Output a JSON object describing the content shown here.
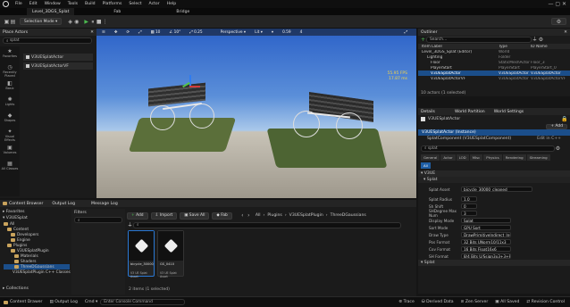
{
  "menubar": {
    "items": [
      "File",
      "Edit",
      "Window",
      "Tools",
      "Build",
      "Platforms",
      "Select",
      "Actor",
      "Help"
    ]
  },
  "tabs": {
    "level": "Level_3DGS_Splat",
    "fab": "Fab",
    "bridge": "Bridge"
  },
  "toolbar": {
    "mode": "Selection Mode"
  },
  "place_actors": {
    "title": "Place Actors",
    "search": "splat",
    "categories": [
      "Favorites",
      "Recently Placed",
      "Basic",
      "Lights",
      "Shapes",
      "Visual Effects",
      "Volumes",
      "All Classes"
    ],
    "results": [
      "V3UESplatActor",
      "V3UESplatActorVF"
    ]
  },
  "viewport": {
    "perspective": "Perspective",
    "lit": "Lit",
    "show": "Show",
    "snap_move": "10",
    "snap_rot": "10°",
    "snap_scale": "0.25",
    "speed": "4",
    "fps_ms": "55.95 FPS",
    "ms": "17.87 ms",
    "cam_speed": "0.59"
  },
  "outliner": {
    "title": "Outliner",
    "search": "Search...",
    "col_label": "Item Label",
    "col_type": "Type",
    "col_idname": "ID Name",
    "rows": [
      {
        "label": "Level_3DGS_Splat (Editor)",
        "type": "World",
        "id": ""
      },
      {
        "label": "Lighting",
        "type": "Folder",
        "id": ""
      },
      {
        "label": "Floor",
        "type": "StaticMeshActor",
        "id": "Floor_3"
      },
      {
        "label": "PlayerStart",
        "type": "PlayerStart",
        "id": "PlayerStart_0"
      },
      {
        "label": "V3UESplatActor",
        "type": "V3UESplatActor",
        "id": "V3UESplatActor"
      },
      {
        "label": "V3UESplatActorVF",
        "type": "V3UESplatActor",
        "id": "V3UESplatActorVF"
      }
    ],
    "summary": "10 actors (1 selected)"
  },
  "details": {
    "tab_details": "Details",
    "tab_world_partition": "World Partition",
    "tab_world_settings": "World Settings",
    "actor_name": "V3UESplatActor",
    "instance": "V3UESplatActor (Instance)",
    "component": "SplatComponent (V3UESplatComponent)",
    "add": "+ Add",
    "edit_cpp": "Edit in C++",
    "search": "splat",
    "cat_tabs": [
      "General",
      "Actor",
      "LOD",
      "Misc",
      "Physics",
      "Rendering",
      "Streaming"
    ],
    "all": "All",
    "section_v3ue": "V3UE",
    "section_splat": "Splat",
    "props": [
      {
        "label": "Splat Asset",
        "value": "bicycle_30000_cleaned"
      },
      {
        "label": "Splat Radius",
        "value": "1.0"
      },
      {
        "label": "Sh Shift",
        "value": "0"
      },
      {
        "label": "SHDegree Max Num",
        "value": "3"
      },
      {
        "label": "Display Mode",
        "value": "Splat"
      },
      {
        "label": "Sort Mode",
        "value": "GPU Sort"
      },
      {
        "label": "Draw Type",
        "value": "DrawPrimitiveIndirect_InstPerSPSheet"
      },
      {
        "label": "Pos Format",
        "value": "32 Bits UNorm10/11x3"
      },
      {
        "label": "Cov Format",
        "value": "16 Bits Float16x6"
      },
      {
        "label": "SH Format",
        "value": "8/4 Bits U/Ssign3x3+3+8x3"
      }
    ],
    "section_bottom": "Splat"
  },
  "content_browser": {
    "tab_cb": "Content Browser",
    "tab_output": "Output Log",
    "tab_msg": "Message Log",
    "add": "Add",
    "import": "Import",
    "save_all": "Save All",
    "fab": "Fab",
    "favorites": "Favorites",
    "project": "V3UESplat",
    "tree": [
      "All",
      "Content",
      "Developers",
      "Engine",
      "Plugins",
      "V3UESplatPlugin",
      "Materials",
      "Shaders",
      "ThreeDGaussians",
      "V3UESplatPlugin C++ Classes"
    ],
    "filters": "Filters",
    "breadcrumb": [
      "All",
      "Plugins",
      "V3UESplatPlugin",
      "ThreeDGaussians"
    ],
    "search_assets": "Search ThreeDGaussians",
    "assets": [
      {
        "name": "bicycle_30000_cleaned",
        "type": "V3 UE Splat Asset"
      },
      {
        "name": "GS_0410",
        "type": "V3 UE Splat Asset"
      }
    ],
    "count": "2 items (1 selected)",
    "collections": "Collections"
  },
  "statusbar": {
    "drawer": "Content Drawer",
    "output": "Output Log",
    "cmd": "Cmd",
    "console": "Enter Console Command",
    "trace": "Trace",
    "derived": "Derived Data",
    "zen": "Zen Server",
    "all_saved": "All Saved",
    "revision": "Revision Control"
  }
}
